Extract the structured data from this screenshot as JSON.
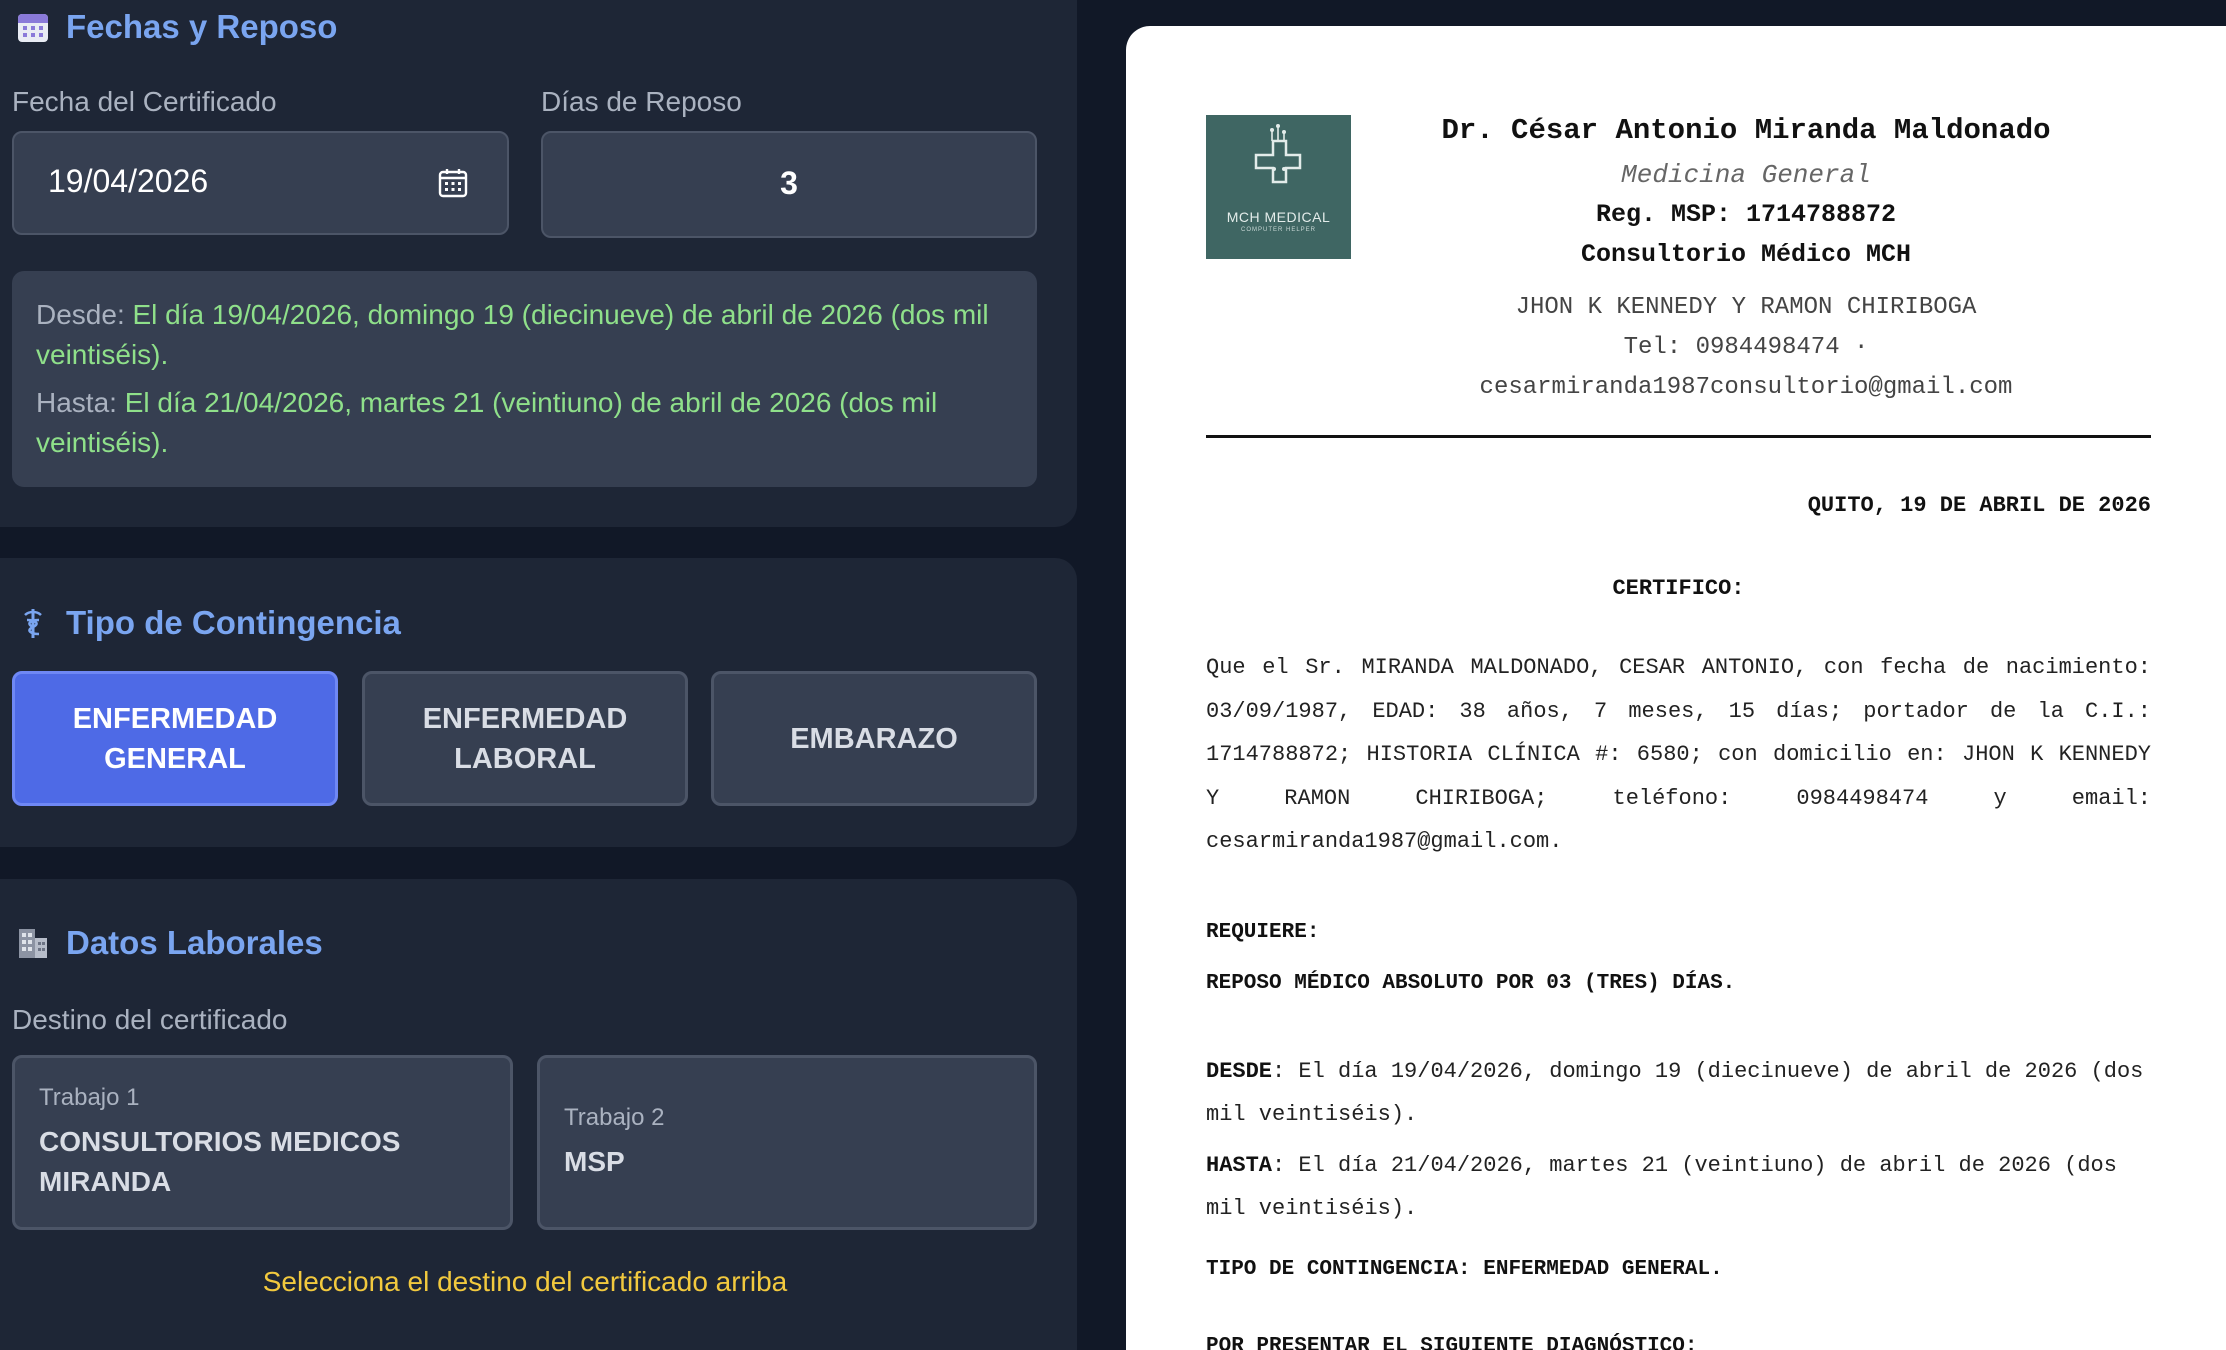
{
  "dates": {
    "title": "Fechas y Reposo",
    "cert_date_label": "Fecha del Certificado",
    "cert_date_value": "19/04/2026",
    "rest_days_label": "Días de Reposo",
    "rest_days_value": "3",
    "from_key": "Desde:",
    "from_value": "El día 19/04/2026, domingo 19 (diecinueve) de abril de 2026 (dos mil veintiséis).",
    "to_key": "Hasta:",
    "to_value": "El día 21/04/2026, martes 21 (veintiuno) de abril de 2026 (dos mil veintiséis)."
  },
  "contingency": {
    "title": "Tipo de Contingencia",
    "options": [
      {
        "label_line1": "ENFERMEDAD",
        "label_line2": "GENERAL",
        "selected": true
      },
      {
        "label_line1": "ENFERMEDAD",
        "label_line2": "LABORAL",
        "selected": false
      },
      {
        "label_line1": "EMBARAZO",
        "label_line2": "",
        "selected": false
      }
    ]
  },
  "work": {
    "title": "Datos Laborales",
    "destination_label": "Destino del certificado",
    "jobs": [
      {
        "tag": "Trabajo 1",
        "name": "CONSULTORIOS MEDICOS MIRANDA"
      },
      {
        "tag": "Trabajo 2",
        "name": "MSP"
      }
    ],
    "hint": "Selecciona el destino del certificado arriba"
  },
  "document": {
    "logo_text": "MCH MEDICAL",
    "logo_subtext": "COMPUTER HELPER",
    "doctor_name": "Dr. César Antonio Miranda Maldonado",
    "specialty": "Medicina General",
    "registration": "Reg. MSP: 1714788872",
    "office": "Consultorio Médico MCH",
    "address": "JHON K KENNEDY Y RAMON CHIRIBOGA",
    "contact": "Tel: 0984498474 · cesarmiranda1987consultorio@gmail.com",
    "place_date": "QUITO, 19 DE ABRIL DE 2026",
    "cert_title": "CERTIFICO:",
    "body": "Que el Sr. MIRANDA MALDONADO, CESAR ANTONIO, con fecha de nacimiento: 03/09/1987, EDAD: 38 años, 7 meses, 15 días; portador de la C.I.: 1714788872; HISTORIA CLÍNICA #: 6580; con domicilio en: JHON K KENNEDY Y RAMON CHIRIBOGA; teléfono: 0984498474 y email: cesarmiranda1987@gmail.com.",
    "requires_title": "REQUIERE:",
    "rest_statement": "REPOSO MÉDICO ABSOLUTO POR 03 (TRES) DÍAS.",
    "from_key": "DESDE",
    "from_value": ": El día 19/04/2026, domingo 19 (diecinueve) de abril de 2026 (dos mil veintiséis).",
    "to_key": "HASTA",
    "to_value": ": El día 21/04/2026, martes 21 (veintiuno) de abril de 2026 (dos mil veintiséis).",
    "contingency_line": "TIPO DE CONTINGENCIA: ENFERMEDAD GENERAL.",
    "diagnosis_title": "POR PRESENTAR EL SIGUIENTE DIAGNÓSTICO:"
  },
  "colors": {
    "background": "#111827",
    "card": "#1e2636",
    "field": "#363f51",
    "accent": "#7aa5f0",
    "selected": "#4e6ae6",
    "date_text": "#8fe08a",
    "hint": "#f2c93e",
    "logo": "#3f6663"
  },
  "icons": {
    "dates_section": "calendar-icon",
    "contingency_section": "caduceus-icon",
    "work_section": "office-building-icon",
    "date_picker": "calendar-picker-icon"
  }
}
